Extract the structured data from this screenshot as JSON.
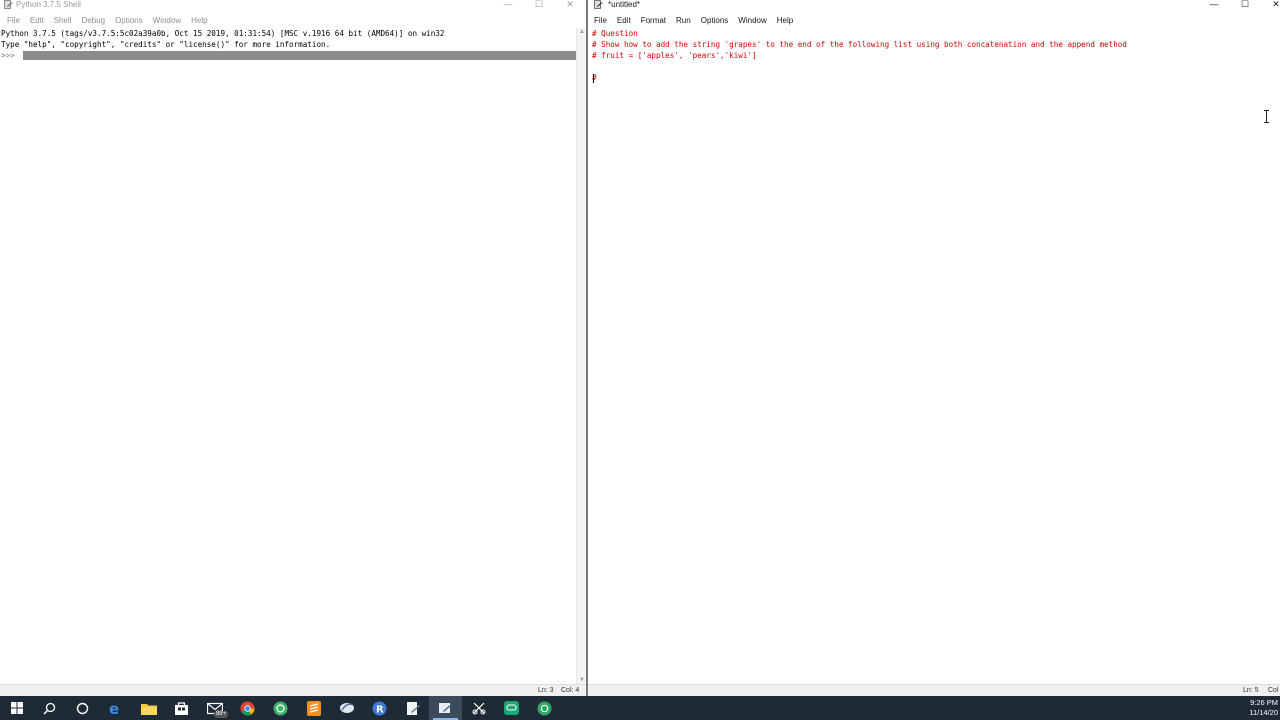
{
  "shell": {
    "title": "Python 3.7.5 Shell",
    "menu": [
      "File",
      "Edit",
      "Shell",
      "Debug",
      "Options",
      "Window",
      "Help"
    ],
    "lines": [
      "Python 3.7.5 (tags/v3.7.5:5c02a39a0b, Oct 15 2019, 01:31:54) [MSC v.1916 64 bit (AMD64)] on win32",
      "Type \"help\", \"copyright\", \"credits\" or \"license()\" for more information."
    ],
    "prompt": ">>> ",
    "status": {
      "line": "Ln: 3",
      "col": "Col: 4"
    }
  },
  "editor": {
    "title": "*untitled*",
    "menu": [
      "File",
      "Edit",
      "Format",
      "Run",
      "Options",
      "Window",
      "Help"
    ],
    "lines": [
      "# Question",
      "# Show how to add the string 'grapes' to the end of the following list using both concatenation and the append method",
      "# fruit = ['apples', 'pears','kiwi']",
      "",
      "#"
    ],
    "status": {
      "line": "Ln: 5",
      "col": "Col"
    }
  },
  "window_controls": {
    "minimize": "—",
    "maximize": "☐",
    "close": "✕"
  },
  "taskbar": {
    "items": [
      {
        "icon": "windows-start-icon"
      },
      {
        "icon": "search-icon"
      },
      {
        "icon": "cortana-circle-icon"
      },
      {
        "icon": "edge-browser-icon"
      },
      {
        "icon": "file-explorer-icon"
      },
      {
        "icon": "store-icon"
      },
      {
        "icon": "mail-icon",
        "badge": "99+"
      },
      {
        "icon": "chrome-icon"
      },
      {
        "icon": "green-app-icon"
      },
      {
        "icon": "sublime-text-icon"
      },
      {
        "icon": "python-feather-icon"
      },
      {
        "icon": "r-language-icon"
      },
      {
        "icon": "python-file-icon"
      },
      {
        "icon": "python-idle-icon",
        "active": true
      },
      {
        "icon": "snipping-tool-icon"
      },
      {
        "icon": "chat-app-icon"
      },
      {
        "icon": "green-circle-app-icon"
      }
    ],
    "clock_time": "9:26 PM",
    "clock_date": "11/14/20"
  },
  "colors": {
    "comment": "#dd0000",
    "taskbar_bg": "#1f2a37",
    "input_highlight": "#8c8c8c"
  }
}
